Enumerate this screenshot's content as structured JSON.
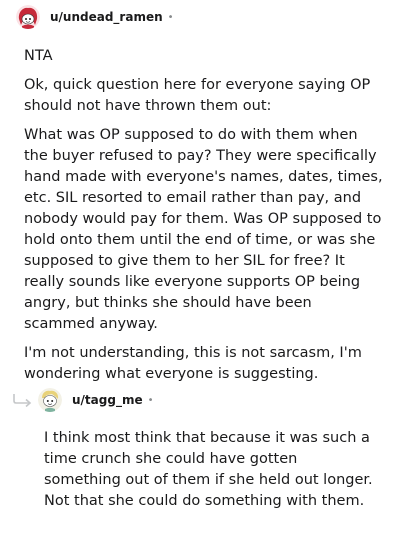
{
  "comments": [
    {
      "username": "u/undead_ramen",
      "separator": "•",
      "avatar": "reddit-snoo-avatar-red-hair",
      "paragraphs": [
        "NTA",
        "Ok, quick question here for everyone saying OP should not have thrown them out:",
        "What was OP supposed to do with them when the buyer refused to pay? They were specifically hand made with everyone's names, dates, times, etc. SIL resorted to email rather than pay, and nobody would pay for them. Was OP supposed to hold onto them until the end of time, or was she supposed to give them to her SIL for free? It really sounds like everyone supports OP being angry, but thinks she should have been scammed anyway.",
        "I'm not understanding, this is not sarcasm, I'm wondering what everyone is suggesting."
      ]
    },
    {
      "username": "u/tagg_me",
      "separator": "•",
      "avatar": "reddit-snoo-avatar-light",
      "reply_icon": "reply-arrow-icon",
      "paragraphs": [
        "I think most think that because it was such a time crunch she could have gotten something out of them if she held out longer. Not that she could do something with them."
      ]
    }
  ]
}
